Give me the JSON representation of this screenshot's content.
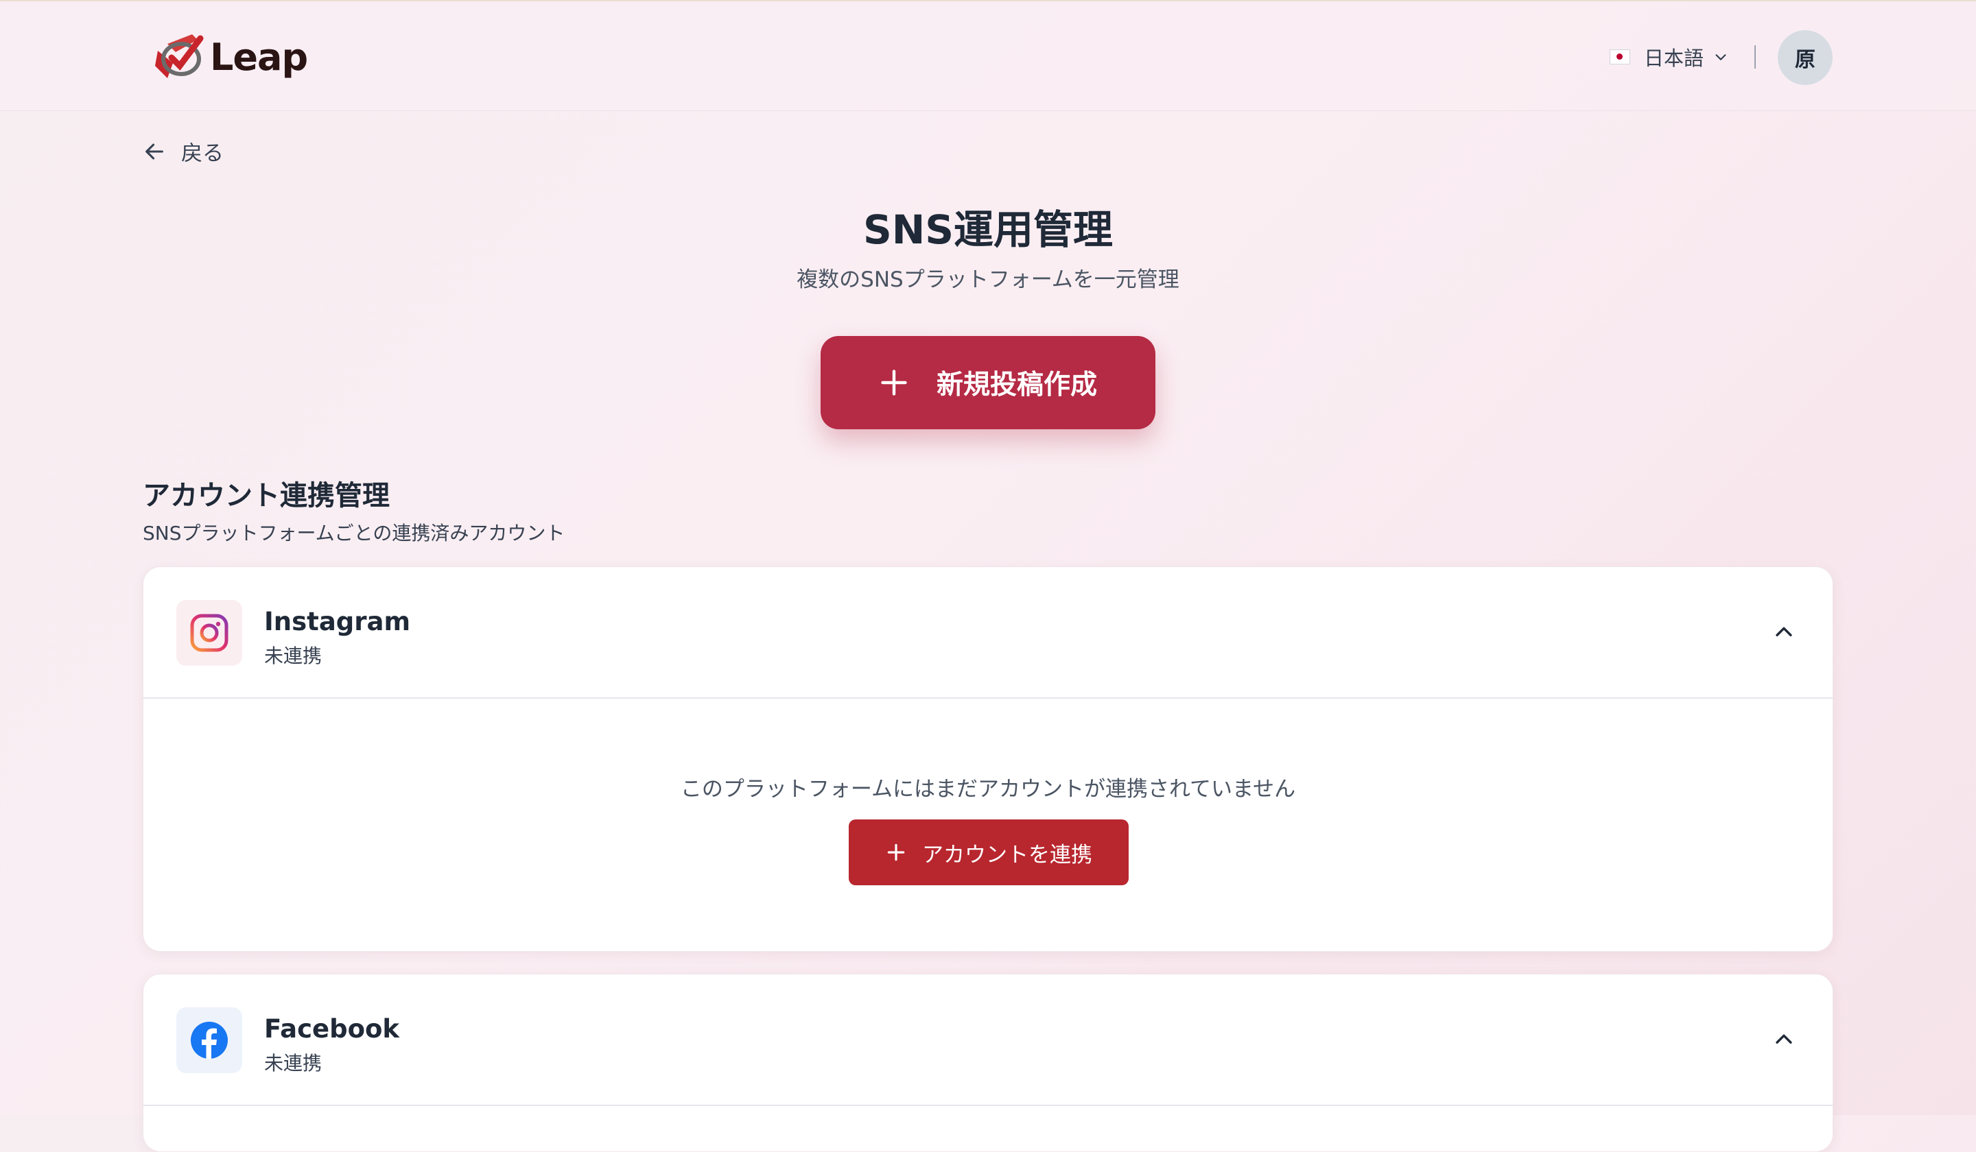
{
  "header": {
    "logo_text": "Leap",
    "language": "日本語",
    "avatar_initial": "原"
  },
  "nav": {
    "back_label": "戻る"
  },
  "page": {
    "title": "SNS運用管理",
    "subtitle": "複数のSNSプラットフォームを一元管理",
    "new_post_label": "新規投稿作成"
  },
  "accounts": {
    "title": "アカウント連携管理",
    "subtitle": "SNSプラットフォームごとの連携済みアカウント",
    "platforms": [
      {
        "name": "Instagram",
        "status": "未連携",
        "empty_message": "このプラットフォームにはまだアカウントが連携されていません",
        "connect_label": "アカウントを連携",
        "icon": "instagram-icon",
        "expanded": true
      },
      {
        "name": "Facebook",
        "status": "未連携",
        "icon": "facebook-icon",
        "expanded": true
      }
    ]
  },
  "colors": {
    "primary": "#b52a44",
    "connect_button": "#b8262e",
    "facebook_blue": "#1877f2"
  }
}
